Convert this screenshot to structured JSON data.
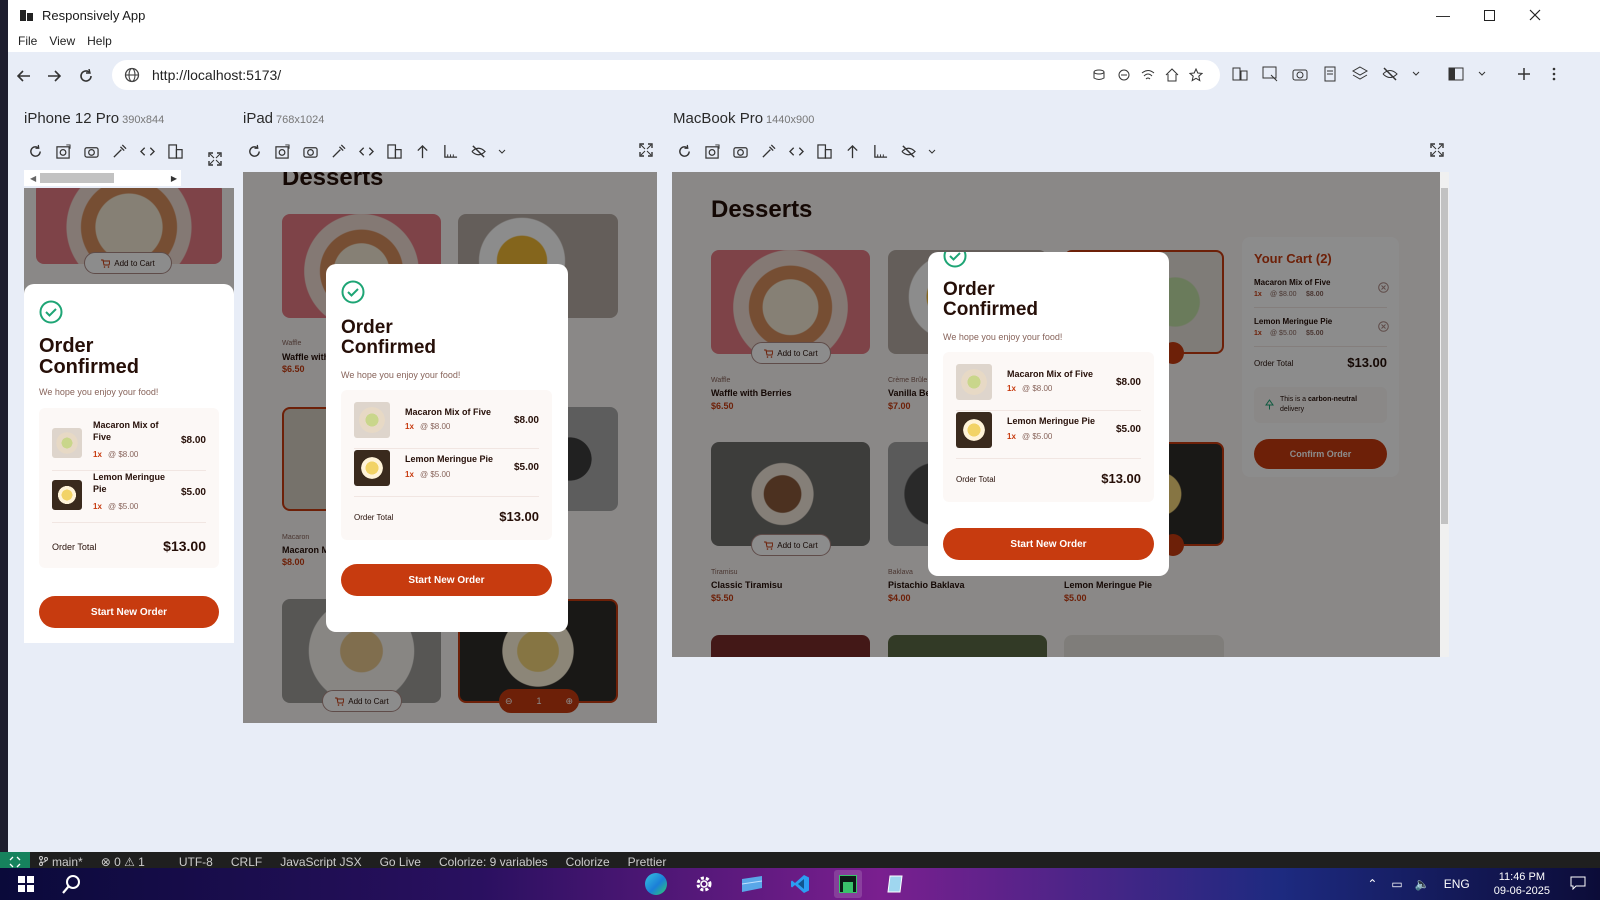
{
  "window": {
    "title": "Responsively App"
  },
  "menu": [
    "File",
    "View",
    "Help"
  ],
  "address": {
    "url": "http://localhost:5173/"
  },
  "devices": [
    {
      "name": "iPhone 12 Pro",
      "size": "390x844"
    },
    {
      "name": "iPad",
      "size": "768x1024"
    },
    {
      "name": "MacBook Pro",
      "size": "1440x900"
    }
  ],
  "app": {
    "heading": "Desserts",
    "add_to_cart": "Add to Cart",
    "products": [
      {
        "category": "Waffle",
        "name": "Waffle with Berries",
        "price": "$6.50"
      },
      {
        "category": "Crème Brûlée",
        "name": "Vanilla Bean Crème Brûlée",
        "price": "$7.00"
      },
      {
        "category": "Macaron",
        "name": "Macaron Mix of Five",
        "price": "$8.00"
      },
      {
        "category": "Tiramisu",
        "name": "Classic Tiramisu",
        "price": "$5.50"
      },
      {
        "category": "Baklava",
        "name": "Pistachio Baklava",
        "price": "$4.00"
      },
      {
        "category": "Pie",
        "name": "Lemon Meringue Pie",
        "price": "$5.00"
      }
    ],
    "ipad_short": {
      "name0": "Waffle with",
      "name2": "Macaron M",
      "cat2": "Macaron"
    },
    "mac_short": {
      "cat1": "Crème Brûle",
      "name1": "Vanilla Be"
    },
    "stepper_qty": "1"
  },
  "modal": {
    "title": "Order Confirmed",
    "subtitle": "We hope you enjoy your food!",
    "items": [
      {
        "name": "Macaron Mix of Five",
        "qty": "1x",
        "unit": "@ $8.00",
        "total": "$8.00"
      },
      {
        "name": "Lemon Meringue Pie",
        "qty": "1x",
        "unit": "@ $5.00",
        "total": "$5.00"
      }
    ],
    "total_label": "Order Total",
    "total_value": "$13.00",
    "button": "Start New Order"
  },
  "cart": {
    "title": "Your Cart (2)",
    "items": [
      {
        "name": "Macaron Mix of Five",
        "qty": "1x",
        "unit": "@ $8.00",
        "total": "$8.00"
      },
      {
        "name": "Lemon Meringue Pie",
        "qty": "1x",
        "unit": "@ $5.00",
        "total": "$5.00"
      }
    ],
    "total_label": "Order Total",
    "total_value": "$13.00",
    "carbon_prefix": "This is a ",
    "carbon_bold": "carbon-neutral",
    "carbon_suffix": " delivery",
    "confirm": "Confirm Order"
  },
  "statusbar": {
    "branch": "main*",
    "problems": "⊗ 0 ⚠ 1",
    "encoding": "UTF-8",
    "eol": "CRLF",
    "language": "JavaScript JSX",
    "golive": "Go Live",
    "colorize_vars": "Colorize: 9 variables",
    "colorize": "Colorize",
    "prettier": "Prettier"
  },
  "taskbar": {
    "lang": "ENG",
    "time": "11:46 PM",
    "date": "09-06-2025"
  },
  "colors": {
    "accent": "#c73b0f",
    "rose900": "#260f08",
    "rose500": "#87635a",
    "green": "#1ea575",
    "rose50": "#fcf8f6"
  }
}
